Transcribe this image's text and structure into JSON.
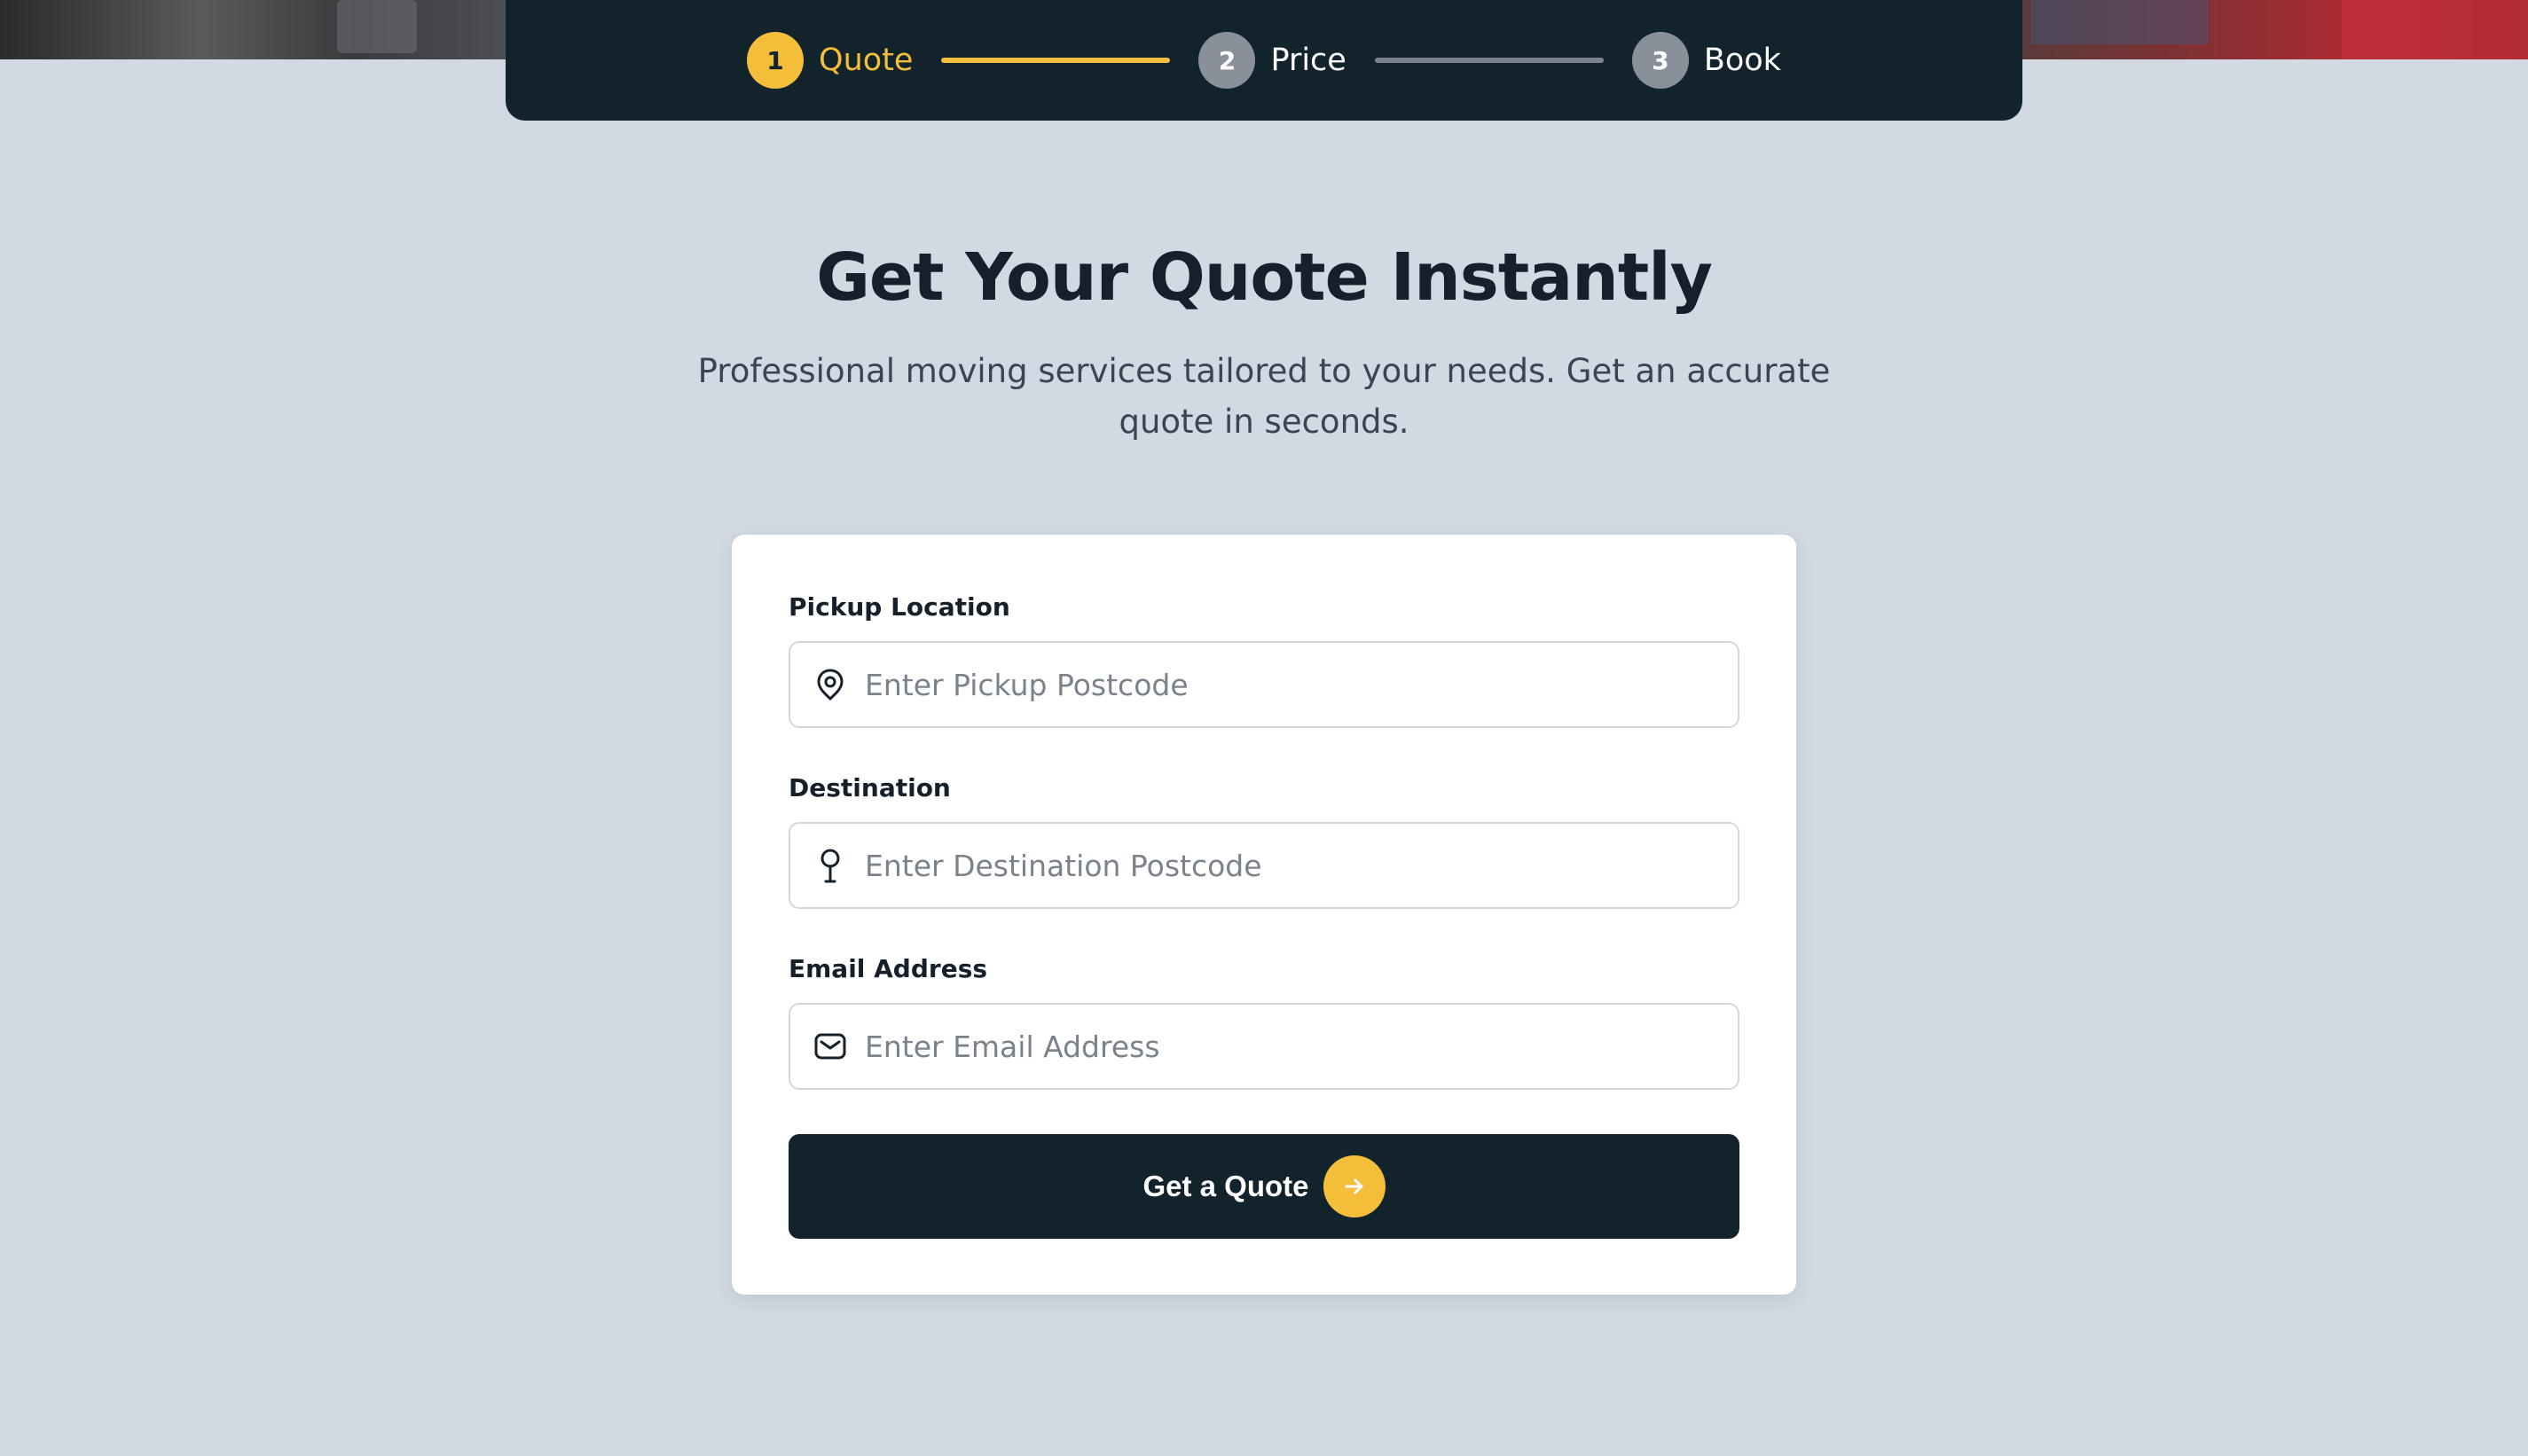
{
  "colors": {
    "background": "#d2d9e2",
    "navy": "#12232c",
    "accent": "#f4bd3a",
    "inactive_step": "#8a909a",
    "card": "#ffffff"
  },
  "stepper": {
    "steps": [
      {
        "number": "1",
        "label": "Quote",
        "state": "active"
      },
      {
        "number": "2",
        "label": "Price",
        "state": "inactive"
      },
      {
        "number": "3",
        "label": "Book",
        "state": "inactive"
      }
    ]
  },
  "hero": {
    "title": "Get Your Quote Instantly",
    "subtitle": "Professional moving services tailored to your needs. Get an accurate quote in seconds."
  },
  "form": {
    "pickup": {
      "label": "Pickup Location",
      "placeholder": "Enter Pickup Postcode",
      "value": "",
      "icon": "map-pin-icon"
    },
    "destination": {
      "label": "Destination",
      "placeholder": "Enter Destination Postcode",
      "value": "",
      "icon": "map-pin-alt-icon"
    },
    "email": {
      "label": "Email Address",
      "placeholder": "Enter Email Address",
      "value": "",
      "icon": "envelope-icon"
    },
    "submit": {
      "label": "Get a Quote",
      "icon": "arrow-right-icon"
    }
  }
}
